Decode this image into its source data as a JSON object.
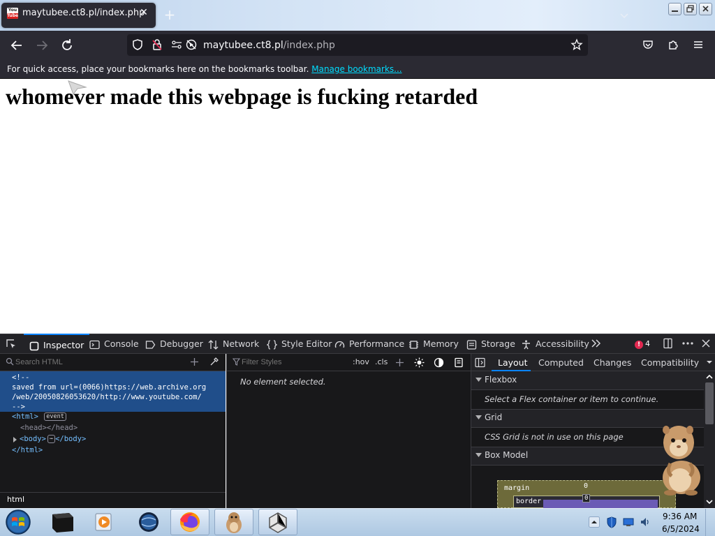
{
  "browser": {
    "tab_title": "maytubee.ct8.pl/index.php",
    "favicon_top": "You",
    "favicon_bottom": "Tube",
    "close_tab_glyph": "✕",
    "new_tab_glyph": "+",
    "url_host": "maytubee.ct8.pl",
    "url_path": "/index.php",
    "bookmarks_text": "For quick access, place your bookmarks here on the bookmarks toolbar.",
    "bookmarks_link": "Manage bookmarks..."
  },
  "page": {
    "heading": "whomever made this webpage is fucking retarded"
  },
  "devtools": {
    "tabs": [
      "Inspector",
      "Console",
      "Debugger",
      "Network",
      "Style Editor",
      "Performance",
      "Memory",
      "Storage",
      "Accessibility"
    ],
    "error_count": "4",
    "error_glyph": "!",
    "search_html_placeholder": "Search HTML",
    "filter_styles_placeholder": "Filter Styles",
    "hov_label": ":hov",
    "cls_label": ".cls",
    "html_tree": {
      "comment": "<!--\nsaved from url=(0066)https://web.archive.org\n/web/20050826053620/http://www.youtube.com/\n-->",
      "html_open": "<html>",
      "event_badge": "event",
      "head": "<head></head>",
      "body_open": "<body>",
      "body_ellipsis": "⋯",
      "body_close": "</body>",
      "html_close": "</html>"
    },
    "breadcrumb": "html",
    "rules_empty": "No element selected.",
    "right_tabs": [
      "Layout",
      "Computed",
      "Changes",
      "Compatibility"
    ],
    "flexbox_title": "Flexbox",
    "flexbox_note": "Select a Flex container or item to continue.",
    "grid_title": "Grid",
    "grid_note": "CSS Grid is not in use on this page",
    "boxmodel_title": "Box Model",
    "margin_label": "margin",
    "margin_value": "0",
    "border_label": "border",
    "border_value": "0"
  },
  "taskbar": {
    "time": "9:36 AM",
    "date": "6/5/2024"
  },
  "colors": {
    "tab_bg": "#2b2a33",
    "url_bg": "#1c1b22",
    "link": "#00ddff",
    "devtools_bg": "#18181a",
    "selection": "#204e8a",
    "accent": "#0a84ff"
  }
}
